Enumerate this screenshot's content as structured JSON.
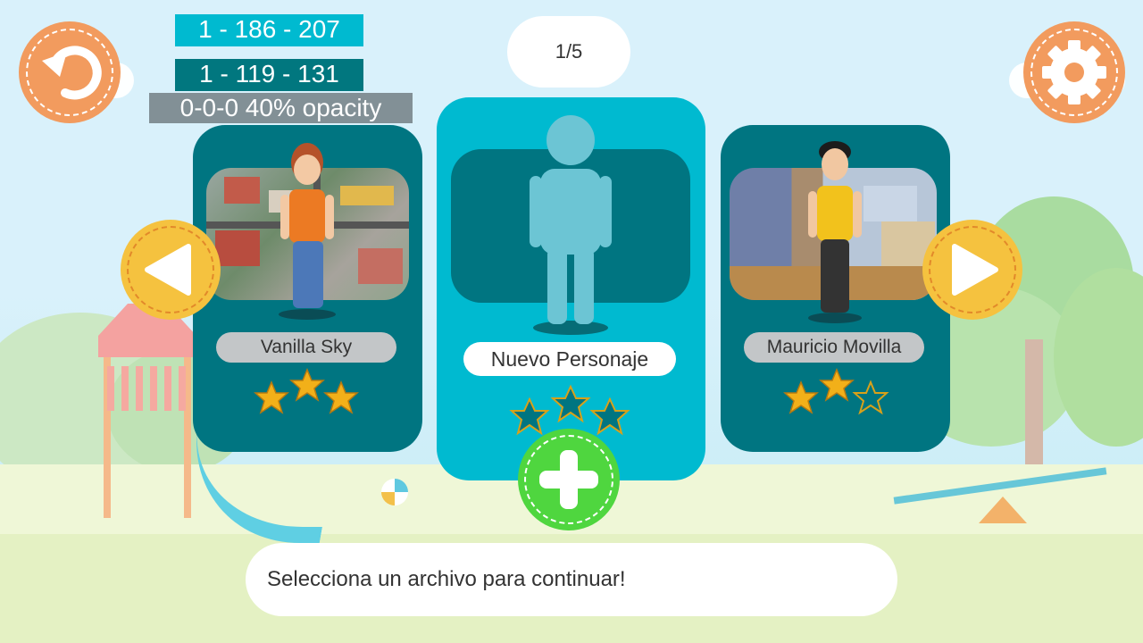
{
  "labels": {
    "swatch_1": "1 - 186 - 207",
    "swatch_2": "1 - 119 - 131",
    "swatch_3": "0-0-0 40% opacity"
  },
  "pager": {
    "text": "1/5"
  },
  "icons": {
    "back": "undo-icon",
    "settings": "gear-icon",
    "prev": "triangle-left-icon",
    "next": "triangle-right-icon",
    "add": "plus-icon"
  },
  "characters": [
    {
      "name": "Vanilla Sky",
      "stars_filled": 3,
      "stars_total": 3
    },
    {
      "name": "Nuevo Personaje",
      "stars_filled": 0,
      "stars_total": 3
    },
    {
      "name": "Mauricio Movilla",
      "stars_filled": 2,
      "stars_total": 3
    }
  ],
  "message": "Selecciona un archivo para continuar!",
  "colors": {
    "accent_cyan": "#00bad0",
    "accent_teal": "#01777f",
    "orange_button": "#f29b5e",
    "yellow_button": "#f5c23f",
    "green_button": "#4fd63f",
    "star_gold": "#f2b019"
  }
}
